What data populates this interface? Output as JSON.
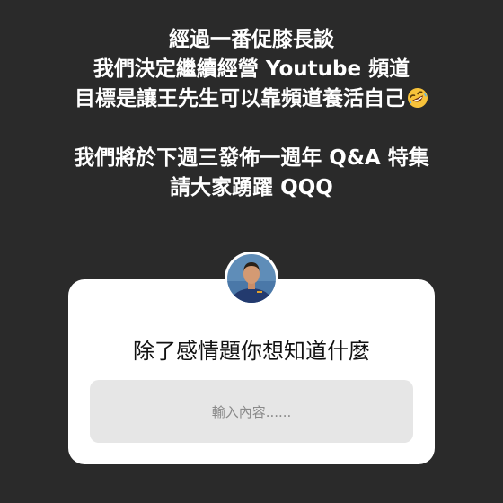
{
  "announcement": {
    "lines": [
      "經過一番促膝長談",
      "我們決定繼續經營 Youtube 頻道",
      "目標是讓王先生可以靠頻道養活自己",
      "我們將於下週三發佈一週年 Q&A 特集",
      "請大家踴躍 QQQ"
    ],
    "emoji_icon": "rolling-on-the-floor-laughing-emoji"
  },
  "question_card": {
    "question": "除了感情題你想知道什麼",
    "input_placeholder": "輸入內容......",
    "avatar_icon": "profile-avatar"
  },
  "colors": {
    "background": "#2a2a2a",
    "text": "#ffffff",
    "card": "#ffffff",
    "input_bg": "#e6e6e6",
    "placeholder": "#8a8a8a"
  }
}
